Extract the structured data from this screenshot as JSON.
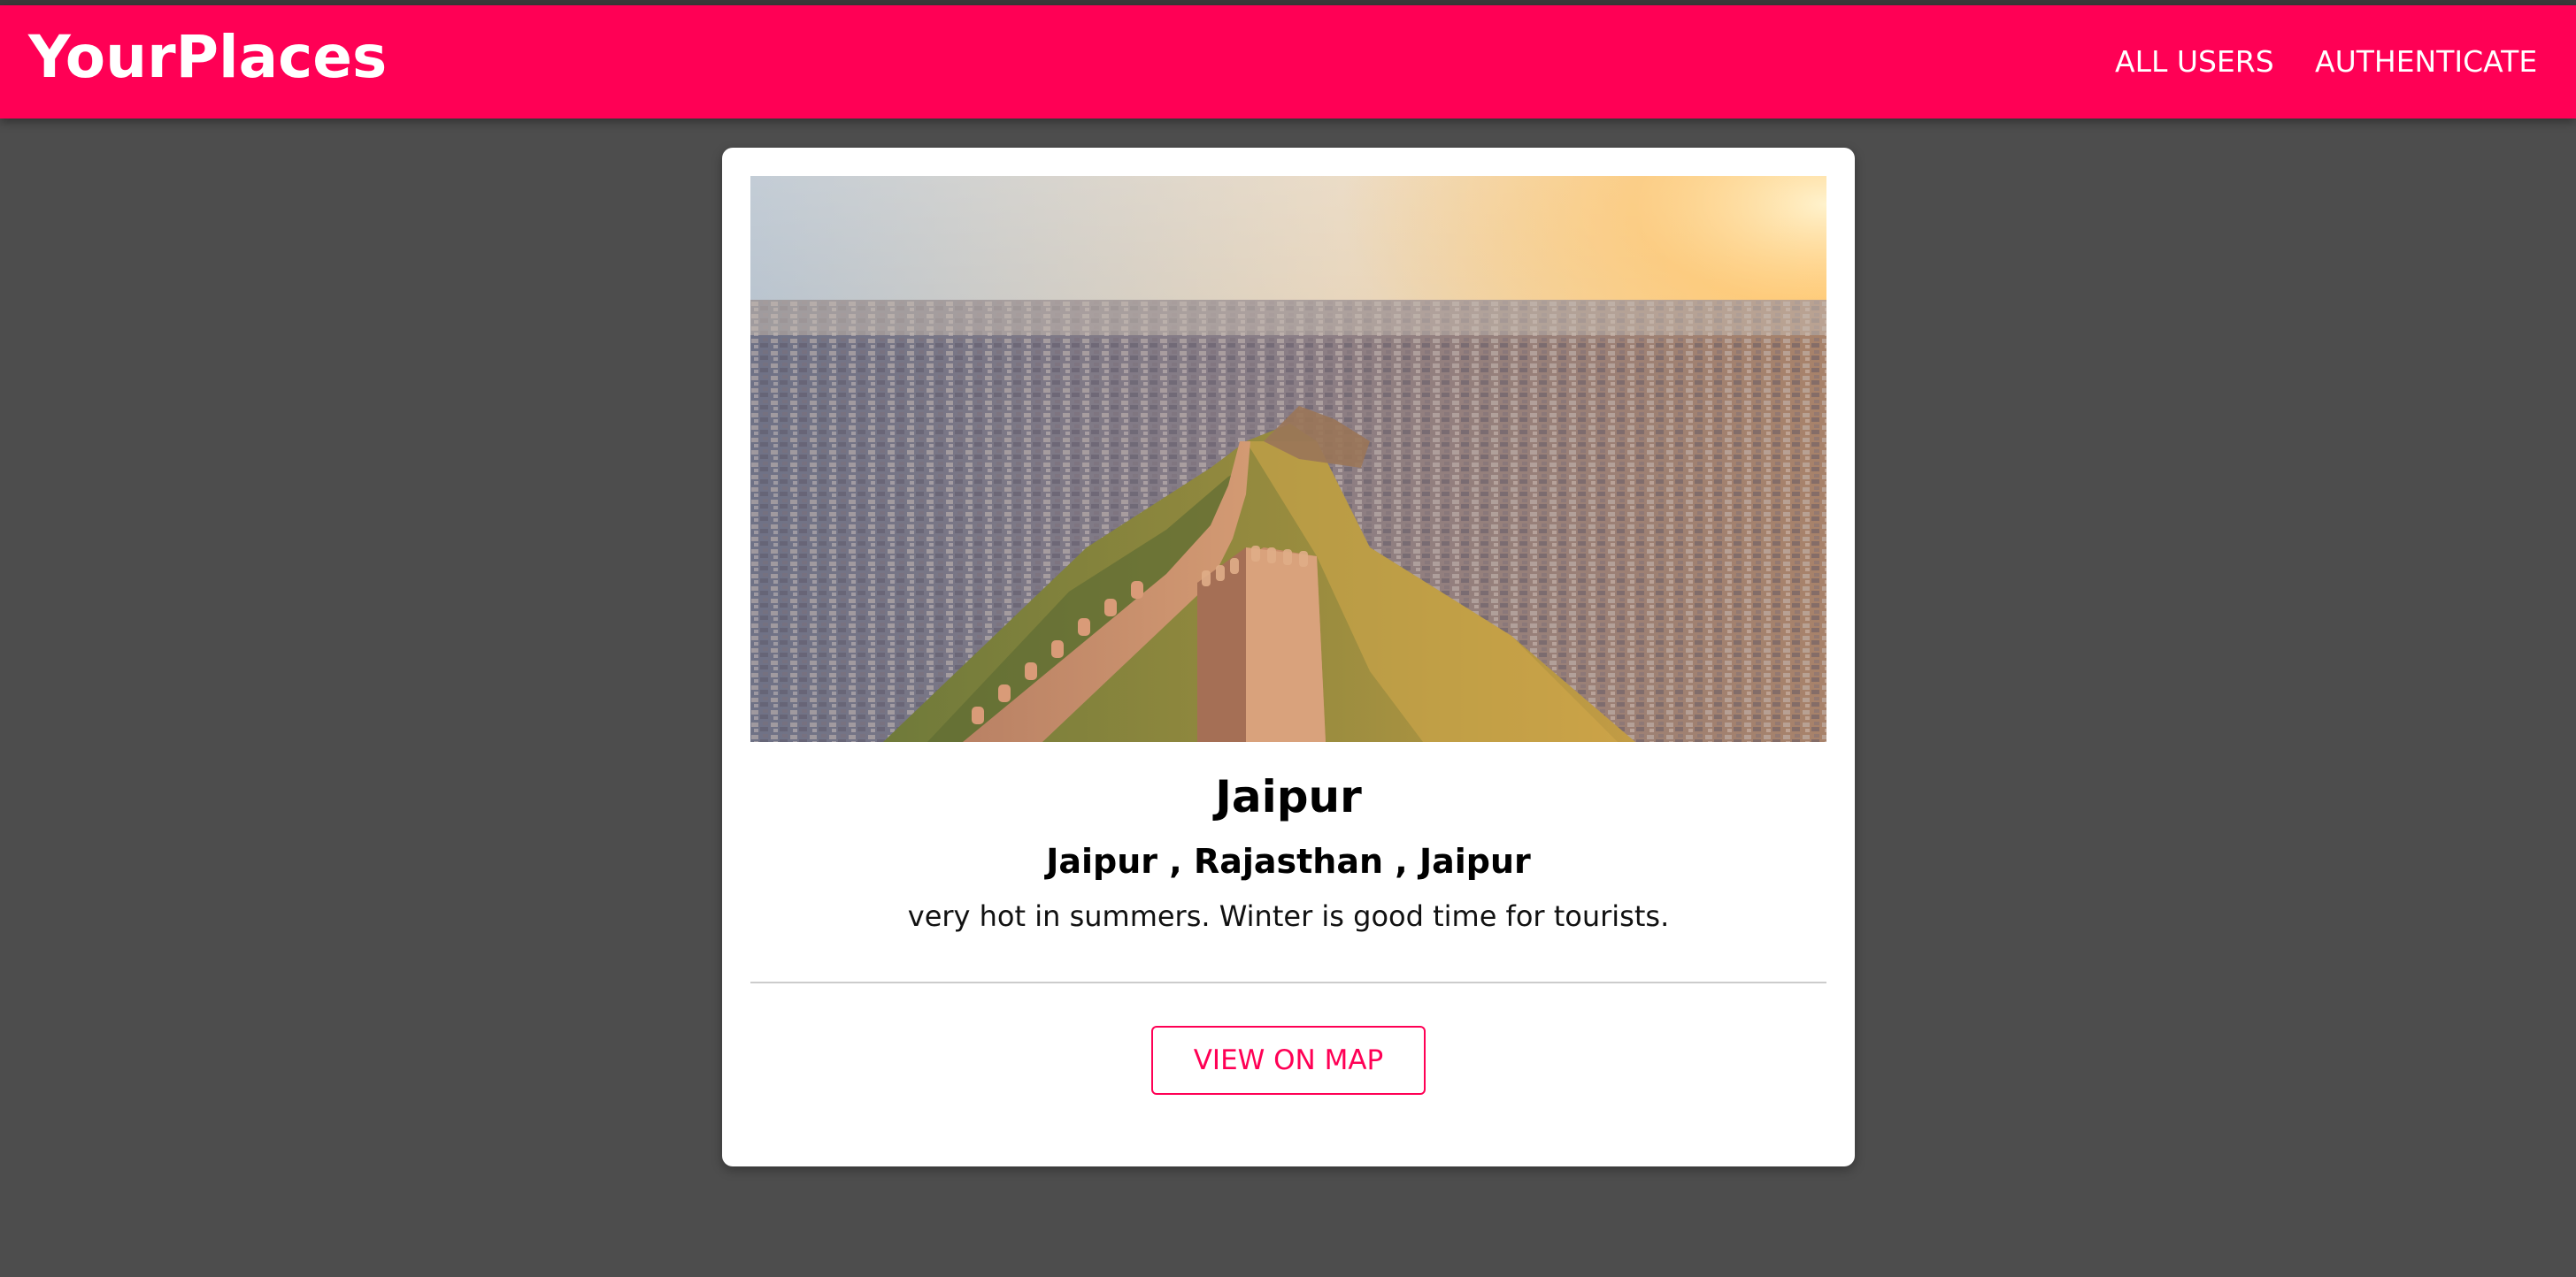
{
  "header": {
    "brand": "YourPlaces",
    "nav": [
      {
        "label": "ALL USERS"
      },
      {
        "label": "AUTHENTICATE"
      }
    ],
    "color": "#ff0055"
  },
  "place": {
    "title": "Jaipur",
    "address": "Jaipur , Rajasthan , Jaipur",
    "description": "very hot in summers. Winter is good time for tourists.",
    "image_subject": "aerial view of fort wall over city at sunset",
    "actions": {
      "view_on_map": "VIEW ON MAP"
    }
  },
  "colors": {
    "accent": "#ff0055",
    "background": "#4d4d4d",
    "card": "#ffffff"
  }
}
